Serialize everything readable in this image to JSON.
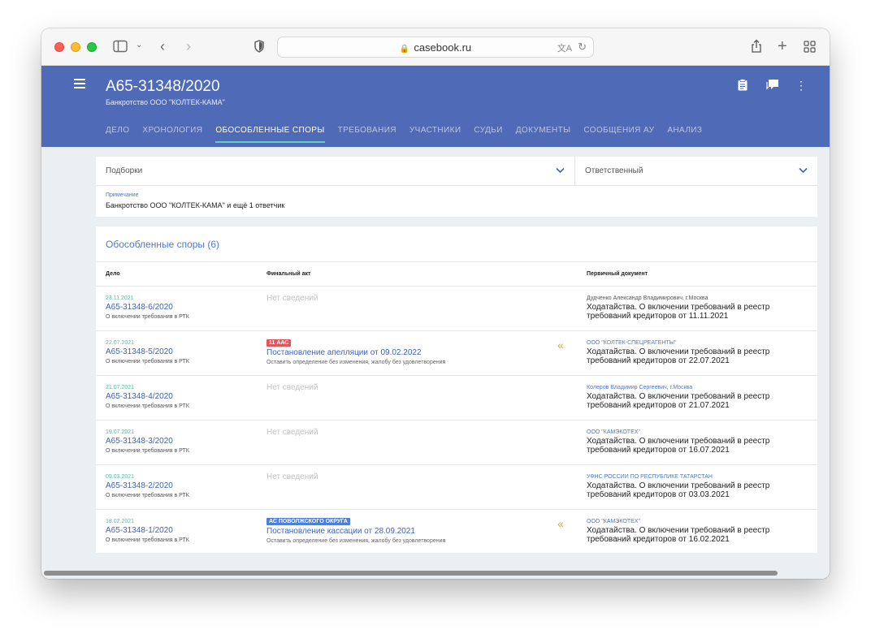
{
  "browser": {
    "url": "casebook.ru"
  },
  "header": {
    "case_number": "А65-31348/2020",
    "case_subtitle": "Банкротство ООО \"КОЛТЕК-КАМА\"",
    "tabs": [
      {
        "label": "ДЕЛО",
        "active": false
      },
      {
        "label": "ХРОНОЛОГИЯ",
        "active": false
      },
      {
        "label": "ОБОСОБЛЕННЫЕ СПОРЫ",
        "active": true
      },
      {
        "label": "ТРЕБОВАНИЯ",
        "active": false
      },
      {
        "label": "УЧАСТНИКИ",
        "active": false
      },
      {
        "label": "СУДЬИ",
        "active": false
      },
      {
        "label": "ДОКУМЕНТЫ",
        "active": false
      },
      {
        "label": "СООБЩЕНИЯ АУ",
        "active": false
      },
      {
        "label": "АНАЛИЗ",
        "active": false
      }
    ]
  },
  "filters": {
    "collections_label": "Подборки",
    "responsible_label": "Ответственный",
    "note_label": "Примечание",
    "note_text": "Банкротство ООО \"КОЛТЕК-КАМА\" и ещё 1 ответчик"
  },
  "table": {
    "title": "Обособленные споры (6)",
    "columns": {
      "case": "Дело",
      "final_act": "Финальный акт",
      "primary_doc": "Первичный документ"
    },
    "rows": [
      {
        "date": "23.11.2021",
        "number": "А65-31348-6/2020",
        "desc": "О включении требования в РТК",
        "no_data": "Нет сведений",
        "party": "Дудченко Александр Владимирович, г.Москва",
        "party_link": false,
        "doc": "Ходатайства. О включении требований в реестр требований кредиторов от 11.11.2021"
      },
      {
        "date": "22.07.2021",
        "number": "А65-31348-5/2020",
        "desc": "О включении требования в РТК",
        "badge": "11 ААС",
        "badge_color": "#e3545a",
        "act_title": "Постановление апелляции от 09.02.2022",
        "act_result": "Оставить определение без изменения, жалобу без удовлетворения",
        "party": "ООО \"КОЛТЕК-СПЕЦРЕАГЕНТЫ\"",
        "party_link": true,
        "doc": "Ходатайства. О включении требований в реестр требований кредиторов от 22.07.2021"
      },
      {
        "date": "21.07.2021",
        "number": "А65-31348-4/2020",
        "desc": "О включении требования в РТК",
        "no_data": "Нет сведений",
        "party": "Колеров Владимир Сергеевич, г.Москва",
        "party_link": true,
        "doc": "Ходатайства. О включении требований в реестр требований кредиторов от 21.07.2021"
      },
      {
        "date": "19.07.2021",
        "number": "А65-31348-3/2020",
        "desc": "О включении требования в РТК",
        "no_data": "Нет сведений",
        "party": "ООО \"КАМЭКОТЕХ\"",
        "party_link": true,
        "doc": "Ходатайства. О включении требований в реестр требований кредиторов от 16.07.2021"
      },
      {
        "date": "09.03.2021",
        "number": "А65-31348-2/2020",
        "desc": "О включении требования в РТК",
        "no_data": "Нет сведений",
        "party": "УФНС РОССИИ ПО РЕСПУБЛИКЕ ТАТАРСТАН",
        "party_link": true,
        "doc": "Ходатайства. О включении требований в реестр требований кредиторов от 03.03.2021"
      },
      {
        "date": "18.02.2021",
        "number": "А65-31348-1/2020",
        "desc": "О включении требования в РТК",
        "badge": "АС ПОВОЛЖСКОГО ОКРУГА",
        "badge_color": "#4e7fd6",
        "act_title": "Постановление кассации от 28.09.2021",
        "act_result": "Оставить определение без изменения, жалобу без удовлетворения",
        "party": "ООО \"КАМЭКОТЕХ\"",
        "party_link": true,
        "doc": "Ходатайства. О включении требований в реестр требований кредиторов от 16.02.2021"
      }
    ]
  },
  "icons": {
    "lock": "lock-icon",
    "translate": "translate-icon",
    "reload": "reload-icon",
    "share": "share-icon",
    "new_tab": "plus-icon",
    "tabs_overview": "grid-icon"
  },
  "colors": {
    "header_bg": "#4f6ab7",
    "tab_indicator": "#5fd0bd",
    "link": "#3f63b8",
    "date": "#62b8a4",
    "arrow": "#e6a23c"
  }
}
